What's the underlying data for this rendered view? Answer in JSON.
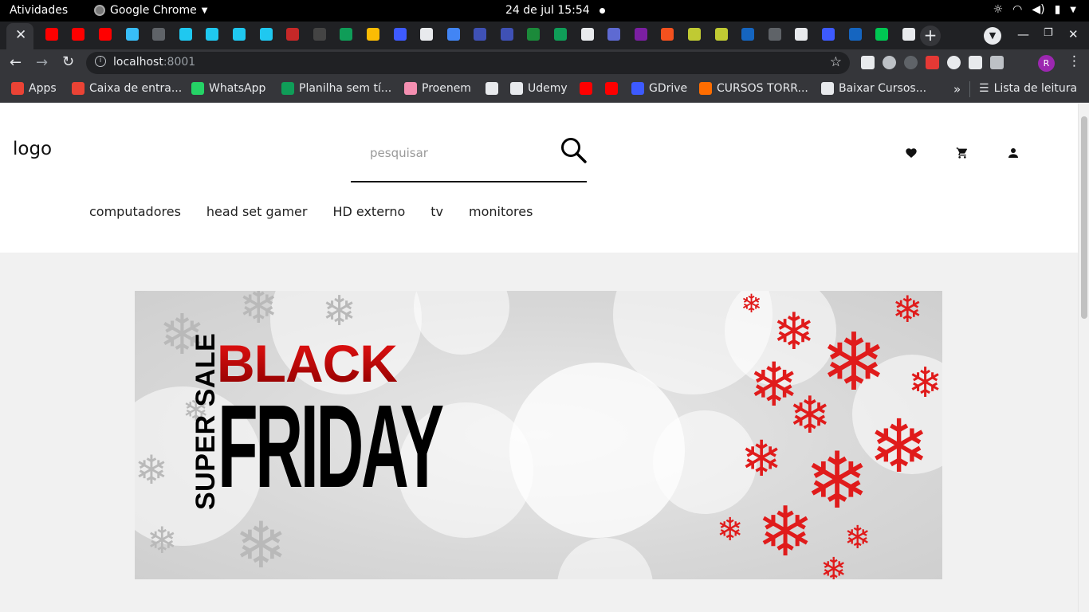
{
  "os": {
    "activities": "Atividades",
    "app_name": "Google Chrome",
    "clock": "24 de jul  15:54"
  },
  "browser": {
    "url_host": "localhost",
    "url_port": ":8001",
    "profile_initial": "R",
    "favicon_colors": [
      "#ff0000",
      "#ff0000",
      "#ff0000",
      "#38bdf8",
      "#5f6368",
      "#1fc8f0",
      "#1fc8f0",
      "#1fc8f0",
      "#1fc8f0",
      "#c62828",
      "#444444",
      "#0f9d58",
      "#fbbc04",
      "#3d5afe",
      "#e8eaed",
      "#4285f4",
      "#3f51b5",
      "#3f51b5",
      "#1b8a3a",
      "#0f9d58",
      "#e8eaed",
      "#5e6ad2",
      "#7b1fa2",
      "#f4511e",
      "#c0ca33",
      "#c0ca33",
      "#1565c0",
      "#5f6368",
      "#e8eaed",
      "#3d5afe",
      "#1565c0",
      "#00c853",
      "#e8eaed"
    ],
    "bookmarks": [
      {
        "label": "Apps",
        "color": "#ea4335"
      },
      {
        "label": "Caixa de entra...",
        "color": "#ea4335"
      },
      {
        "label": "WhatsApp",
        "color": "#25d366"
      },
      {
        "label": "Planilha sem tí...",
        "color": "#0f9d58"
      },
      {
        "label": "Proenem",
        "color": "#f48fb1"
      },
      {
        "label": "",
        "color": "#e8eaed"
      },
      {
        "label": "Udemy",
        "color": "#e8eaed"
      },
      {
        "label": "",
        "color": "#ff0000"
      },
      {
        "label": "",
        "color": "#ff0000"
      },
      {
        "label": "GDrive",
        "color": "#3d5afe"
      },
      {
        "label": "CURSOS TORR...",
        "color": "#ff6d00"
      },
      {
        "label": "Baixar Cursos...",
        "color": "#e8eaed"
      }
    ],
    "reading_list": "Lista de leitura"
  },
  "site": {
    "logo": "logo",
    "search_placeholder": "pesquisar",
    "nav": [
      "computadores",
      "head set gamer",
      "HD externo",
      "tv",
      "monitores"
    ],
    "banner": {
      "super_sale": "SUPER SALE",
      "black": "BLACK",
      "friday": "FRIDAY"
    }
  }
}
